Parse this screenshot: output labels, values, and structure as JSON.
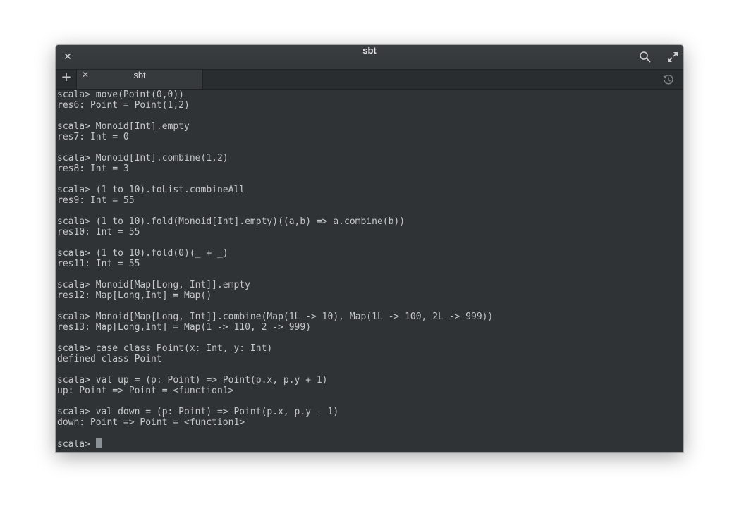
{
  "window": {
    "title": "sbt"
  },
  "tabs": [
    {
      "label": "sbt"
    }
  ],
  "terminal": {
    "lines": [
      "scala> move(Point(0,0))",
      "res6: Point = Point(1,2)",
      "",
      "scala> Monoid[Int].empty",
      "res7: Int = 0",
      "",
      "scala> Monoid[Int].combine(1,2)",
      "res8: Int = 3",
      "",
      "scala> (1 to 10).toList.combineAll",
      "res9: Int = 55",
      "",
      "scala> (1 to 10).fold(Monoid[Int].empty)((a,b) => a.combine(b))",
      "res10: Int = 55",
      "",
      "scala> (1 to 10).fold(0)(_ + _)",
      "res11: Int = 55",
      "",
      "scala> Monoid[Map[Long, Int]].empty",
      "res12: Map[Long,Int] = Map()",
      "",
      "scala> Monoid[Map[Long, Int]].combine(Map(1L -> 10), Map(1L -> 100, 2L -> 999))",
      "res13: Map[Long,Int] = Map(1 -> 110, 2 -> 999)",
      "",
      "scala> case class Point(x: Int, y: Int)",
      "defined class Point",
      "",
      "scala> val up = (p: Point) => Point(p.x, p.y + 1)",
      "up: Point => Point = <function1>",
      "",
      "scala> val down = (p: Point) => Point(p.x, p.y - 1)",
      "down: Point => Point = <function1>",
      ""
    ],
    "prompt": "scala> "
  },
  "icons": {
    "close": "close-icon",
    "search": "search-icon",
    "maximize": "maximize-icon",
    "add_tab": "plus-icon",
    "history": "history-icon"
  },
  "colors": {
    "background": "#2f3336",
    "text": "#c5c8c6",
    "cursor": "#8a9297"
  }
}
